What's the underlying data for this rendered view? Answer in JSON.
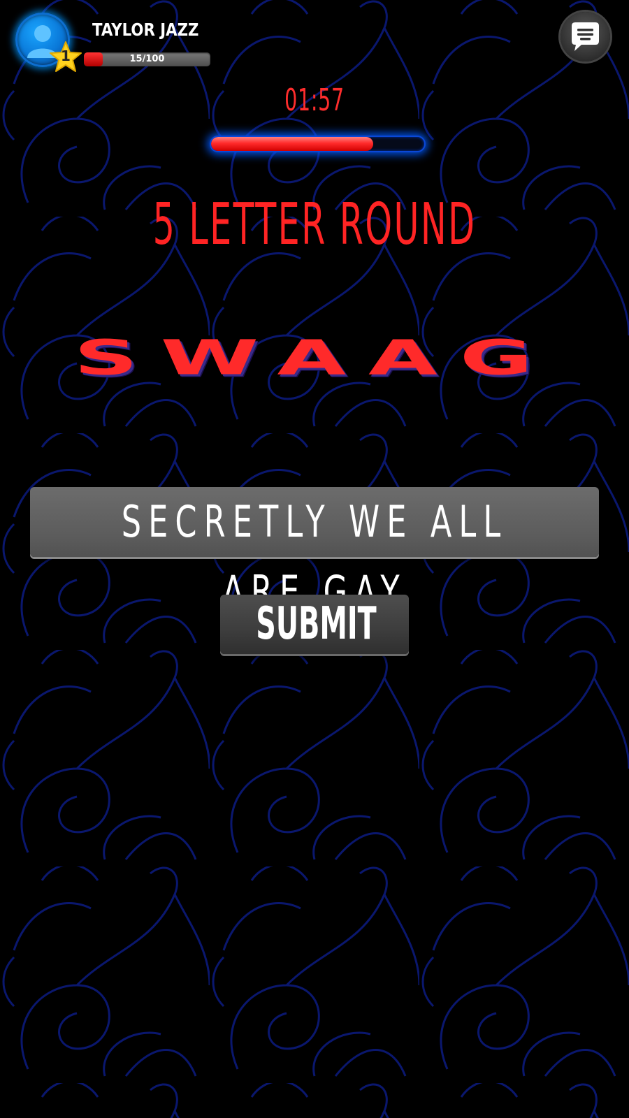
{
  "player": {
    "name": "TAYLOR JAZZ",
    "level": "1",
    "xp_text": "15/100",
    "xp_fraction": 0.15,
    "avatar_icon": "user-silhouette-icon"
  },
  "header": {
    "chat_icon": "chat-bubble-icon"
  },
  "round": {
    "timer": "01:57",
    "time_remaining_fraction": 0.76,
    "title": "5 LETTER ROUND",
    "word": "SWAAG"
  },
  "answer": {
    "value": "SECRETLY WE ALL ARE GAY"
  },
  "actions": {
    "submit_label": "SUBMIT"
  },
  "colors": {
    "accent_red": "#ff2a2a",
    "glow_blue": "#0a48d8",
    "background": "#000000",
    "pattern": "#0b1a7a"
  }
}
